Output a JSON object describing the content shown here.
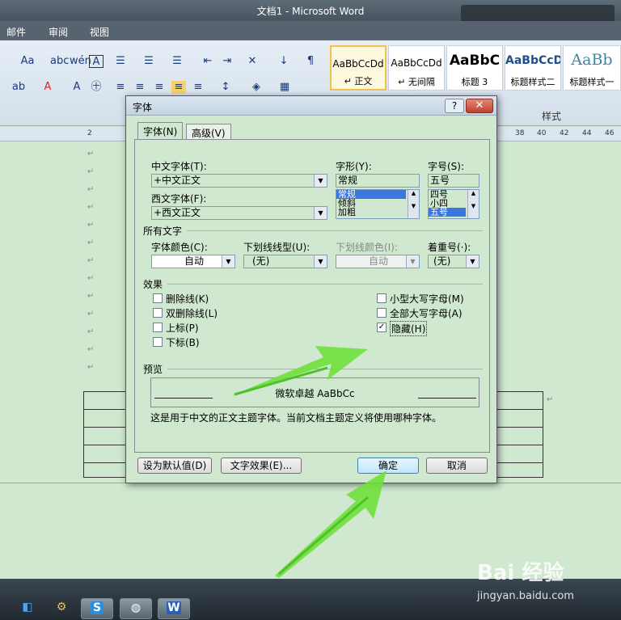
{
  "window": {
    "title": "文档1 - Microsoft Word"
  },
  "menu": {
    "items": [
      "邮件",
      "审阅",
      "视图"
    ]
  },
  "ribbon": {
    "font_size_icon": "Aa",
    "styles": [
      {
        "sample": "AaBbCcDd",
        "name": "↵ 正文"
      },
      {
        "sample": "AaBbCcDd",
        "name": "↵ 无间隔"
      },
      {
        "sample": "AaBbC",
        "name": "标题 3"
      },
      {
        "sample": "AaBbCcD",
        "name": "标题样式二"
      },
      {
        "sample": "AaBb",
        "name": "标题样式一"
      }
    ],
    "group_label": "样式"
  },
  "ruler": {
    "ticks": [
      "2",
      "38",
      "40",
      "42",
      "44",
      "46"
    ]
  },
  "dialog": {
    "title": "字体",
    "help": "?",
    "close": "✕",
    "tabs": [
      "字体(N)",
      "高级(V)"
    ],
    "chinese_font_label": "中文字体(T):",
    "chinese_font_value": "+中文正文",
    "western_font_label": "西文字体(F):",
    "western_font_value": "+西文正文",
    "style_label": "字形(Y):",
    "style_value": "常规",
    "style_options": [
      "常规",
      "倾斜",
      "加粗"
    ],
    "size_label": "字号(S):",
    "size_value": "五号",
    "size_options": [
      "四号",
      "小四",
      "五号"
    ],
    "all_text_label": "所有文字",
    "font_color_label": "字体颜色(C):",
    "font_color_value": "自动",
    "underline_style_label": "下划线线型(U):",
    "underline_style_value": "(无)",
    "underline_color_label": "下划线颜色(I):",
    "underline_color_value": "自动",
    "emphasis_label": "着重号(·):",
    "emphasis_value": "(无)",
    "effects_label": "效果",
    "effects": [
      {
        "label": "删除线(K)",
        "checked": false
      },
      {
        "label": "双删除线(L)",
        "checked": false
      },
      {
        "label": "上标(P)",
        "checked": false
      },
      {
        "label": "下标(B)",
        "checked": false
      }
    ],
    "effects_right": [
      {
        "label": "小型大写字母(M)",
        "checked": false
      },
      {
        "label": "全部大写字母(A)",
        "checked": false
      },
      {
        "label": "隐藏(H)",
        "checked": true
      }
    ],
    "preview_label": "预览",
    "preview_sample": "微软卓越  AaBbCc",
    "preview_note": "这是用于中文的正文主题字体。当前文档主题定义将使用哪种字体。",
    "set_default_button": "设为默认值(D)",
    "text_effects_button": "文字效果(E)...",
    "ok_button": "确定",
    "cancel_button": "取消"
  },
  "watermark": {
    "brand": "Bai 经验",
    "url": "jingyan.baidu.com"
  },
  "colors": {
    "doc_bg": "#cfe8cf",
    "arrow": "#6fe03a",
    "selection": "#3a78e0"
  }
}
